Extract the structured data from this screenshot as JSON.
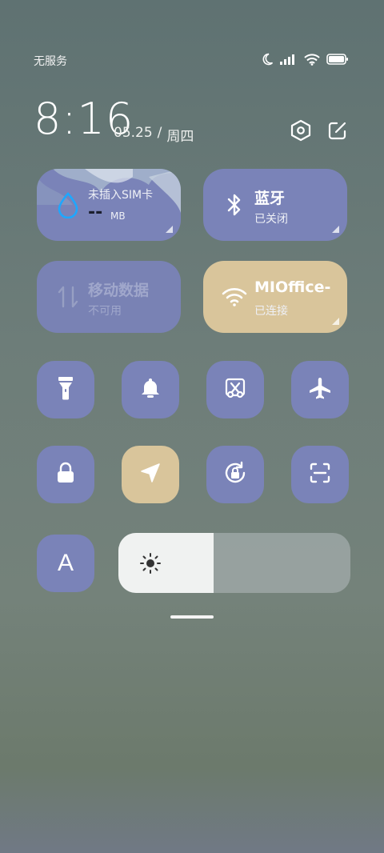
{
  "status": {
    "carrier": "无服务"
  },
  "clock": {
    "time": "8:16",
    "date": "05.25",
    "separator": "/",
    "weekday": "周四"
  },
  "tiles": {
    "data_usage": {
      "title": "未插入SIM卡",
      "value": "--",
      "unit": "MB"
    },
    "bluetooth": {
      "title": "蓝牙",
      "status": "已关闭"
    },
    "mobile_data": {
      "title": "移动数据",
      "status": "不可用"
    },
    "wifi": {
      "title": "MIOffice-",
      "status": "已连接"
    }
  },
  "toggles": [
    {
      "name": "flashlight",
      "active": false
    },
    {
      "name": "silent-bell",
      "active": false
    },
    {
      "name": "screenshot-scissors",
      "active": false
    },
    {
      "name": "airplane-mode",
      "active": false
    },
    {
      "name": "lock-screen",
      "active": false
    },
    {
      "name": "location",
      "active": true
    },
    {
      "name": "rotation-lock",
      "active": false
    },
    {
      "name": "scanner",
      "active": false
    }
  ],
  "auto_brightness": {
    "label": "A"
  },
  "brightness": {
    "level": 0.41
  },
  "colors": {
    "tile_blue": "#7a83b8",
    "tile_active": "#d9c59b",
    "slider_fill": "#f0f2f1"
  }
}
